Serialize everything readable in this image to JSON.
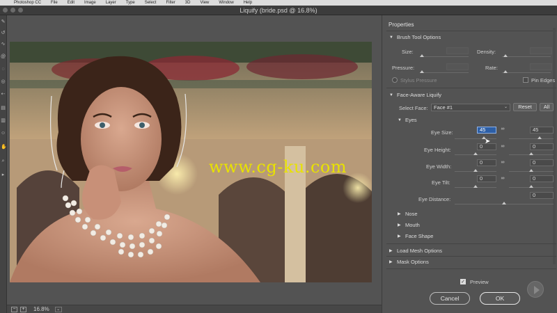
{
  "menubar": {
    "items": [
      "Photoshop CC",
      "File",
      "Edit",
      "Image",
      "Layer",
      "Type",
      "Select",
      "Filter",
      "3D",
      "View",
      "Window",
      "Help"
    ]
  },
  "window": {
    "title": "Liquify (bride.psd @ 16.8%)"
  },
  "watermark": "www.cg-ku.com",
  "statusbar": {
    "zoom": "16.8%",
    "minus": "−",
    "plus": "+"
  },
  "panel": {
    "title": "Properties",
    "brush": {
      "section": "Brush Tool Options",
      "size_label": "Size:",
      "density_label": "Density:",
      "pressure_label": "Pressure:",
      "rate_label": "Rate:",
      "stylus_label": "Stylus Pressure",
      "pin_label": "Pin Edges"
    },
    "face": {
      "section": "Face-Aware Liquify",
      "select_label": "Select Face:",
      "select_value": "Face #1",
      "reset": "Reset",
      "all": "All",
      "eyes": {
        "section": "Eyes",
        "size_label": "Eye Size:",
        "size_left": "45",
        "size_right": "45",
        "height_label": "Eye Height:",
        "height_left": "0",
        "height_right": "0",
        "width_label": "Eye Width:",
        "width_left": "0",
        "width_right": "0",
        "tilt_label": "Eye Tilt:",
        "tilt_left": "0",
        "tilt_right": "0",
        "distance_label": "Eye Distance:",
        "distance_value": "0"
      },
      "nose": "Nose",
      "mouth": "Mouth",
      "face_shape": "Face Shape"
    },
    "mesh": "Load Mesh Options",
    "mask": "Mask Options",
    "preview_label": "Preview",
    "cancel": "Cancel",
    "ok": "OK"
  }
}
